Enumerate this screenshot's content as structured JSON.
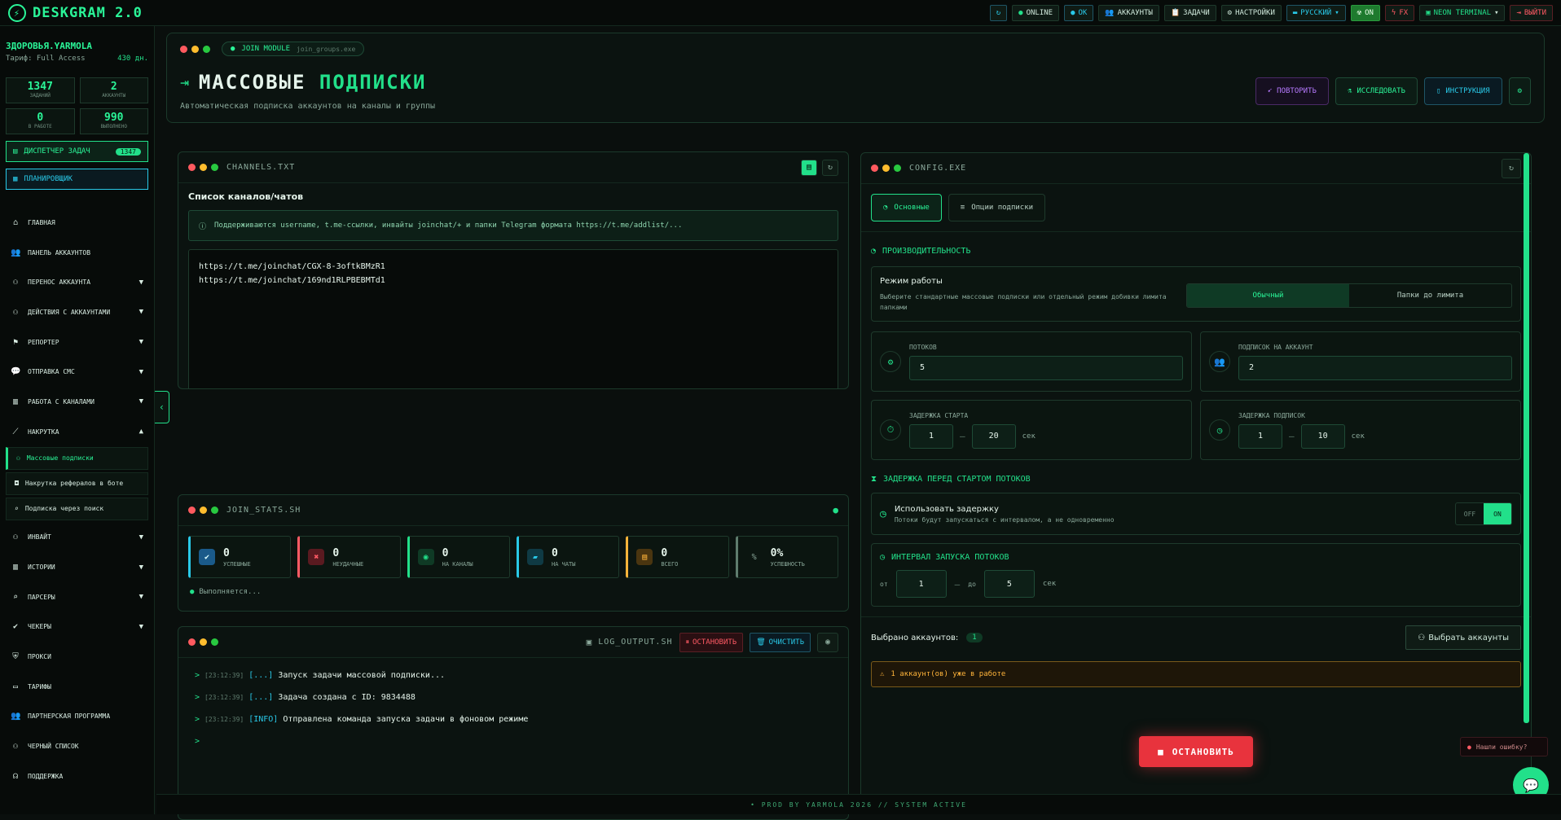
{
  "app": {
    "title": "DESKGRAM 2.0"
  },
  "topbar": {
    "online": "ONLINE",
    "ok": "OK",
    "accounts": "АККАУНТЫ",
    "tasks": "ЗАДАЧИ",
    "settings": "НАСТРОЙКИ",
    "language": "РУССКИЙ",
    "on": "ON",
    "fx": "FX",
    "theme": "NEON TERMINAL",
    "logout": "ВЫЙТИ"
  },
  "user": {
    "name": "ЗДОРОВЬЯ.YARMOLA",
    "plan_label": "Тариф: Full Access",
    "days": "430 дн."
  },
  "stats": [
    {
      "n": "1347",
      "l": "ЗАДАНИЙ"
    },
    {
      "n": "2",
      "l": "АККАУНТЫ"
    },
    {
      "n": "0",
      "l": "В РАБОТЕ"
    },
    {
      "n": "990",
      "l": "ВЫПОЛНЕНО"
    }
  ],
  "sidebar": {
    "dispatcher": "ДИСПЕТЧЕР ЗАДАЧ",
    "dispatcher_count": "1347",
    "scheduler": "ПЛАНИРОВЩИК",
    "items": [
      {
        "label": "ГЛАВНАЯ",
        "ch": ""
      },
      {
        "label": "ПАНЕЛЬ АККАУНТОВ",
        "ch": ""
      },
      {
        "label": "ПЕРЕНОС АККАУНТА",
        "ch": "▼"
      },
      {
        "label": "ДЕЙСТВИЯ С АККАУНТАМИ",
        "ch": "▼"
      },
      {
        "label": "РЕПОРТЕР",
        "ch": "▼"
      },
      {
        "label": "ОТПРАВКА СМС",
        "ch": "▼"
      },
      {
        "label": "РАБОТА С КАНАЛАМИ",
        "ch": "▼"
      },
      {
        "label": "НАКРУТКА",
        "ch": "▲"
      }
    ],
    "subitems": [
      "Массовые подписки",
      "Накрутка рефералов в боте",
      "Подписка через поиск"
    ],
    "items2": [
      {
        "label": "ИНВАЙТ",
        "ch": "▼"
      },
      {
        "label": "ИСТОРИИ",
        "ch": "▼"
      },
      {
        "label": "ПАРСЕРЫ",
        "ch": "▼"
      },
      {
        "label": "ЧЕКЕРЫ",
        "ch": "▼"
      },
      {
        "label": "ПРОКСИ",
        "ch": ""
      },
      {
        "label": "ТАРИФЫ",
        "ch": ""
      },
      {
        "label": "ПАРТНЕРСКАЯ ПРОГРАММА",
        "ch": ""
      },
      {
        "label": "ЧЕРНЫЙ СПИСОК",
        "ch": ""
      },
      {
        "label": "ПОДДЕРЖКА",
        "ch": ""
      }
    ]
  },
  "header": {
    "module": "JOIN MODULE",
    "module_file": "join_groups.exe",
    "title_a": "МАССОВЫЕ ",
    "title_b": "ПОДПИСКИ",
    "subtitle": "Автоматическая подписка аккаунтов на каналы и группы",
    "btn_repeat": "ПОВТОРИТЬ",
    "btn_explore": "ИССЛЕДОВАТЬ",
    "btn_guide": "ИНСТРУКЦИЯ"
  },
  "channels": {
    "file": "CHANNELS.TXT",
    "heading": "Список каналов/чатов",
    "info": "Поддерживаются username, t.me-ссылки, инвайты joinchat/+ и папки Telegram формата https://t.me/addlist/...",
    "lines": [
      "https://t.me/joinchat/CGX-8-3oftkBMzR1",
      "https://t.me/joinchat/169nd1RLPBEBMTd1"
    ]
  },
  "join_stats": {
    "file": "JOIN_STATS.SH",
    "cards": [
      {
        "n": "0",
        "l": "УСПЕШНЫЕ"
      },
      {
        "n": "0",
        "l": "НЕУДАЧНЫЕ"
      },
      {
        "n": "0",
        "l": "НА КАНАЛЫ"
      },
      {
        "n": "0",
        "l": "НА ЧАТЫ"
      },
      {
        "n": "0",
        "l": "ВСЕГО"
      },
      {
        "n": "0%",
        "l": "УСПЕШНОСТЬ"
      }
    ],
    "status": "Выполняется..."
  },
  "log": {
    "file": "LOG_OUTPUT.SH",
    "stop": "ОСТАНОВИТЬ",
    "clear": "ОЧИСТИТЬ",
    "lines": [
      {
        "t": "[23:12:39]",
        "tag": "[...]",
        "msg": "Запуск задачи массовой подписки..."
      },
      {
        "t": "[23:12:39]",
        "tag": "[...]",
        "msg": "Задача создана с ID: 9834488"
      },
      {
        "t": "[23:12:39]",
        "tag": "[INFO]",
        "msg": "Отправлена команда запуска задачи в фоновом режиме"
      }
    ]
  },
  "config": {
    "file": "CONFIG.EXE",
    "tab_main": "Основные",
    "tab_opts": "Опции подписки",
    "perf": "ПРОИЗВОДИТЕЛЬНОСТЬ",
    "mode_title": "Режим работы",
    "mode_desc": "Выберите стандартные массовые подписки или отдельный режим добивки лимита папками",
    "mode_normal": "Обычный",
    "mode_folders": "Папки до лимита",
    "threads_label": "ПОТОКОВ",
    "threads": "5",
    "subs_label": "ПОДПИСОК НА АККАУНТ",
    "subs": "2",
    "start_delay_label": "ЗАДЕРЖКА СТАРТА",
    "start_from": "1",
    "start_to": "20",
    "sec": "сек",
    "sub_delay_label": "ЗАДЕРЖКА ПОДПИСОК",
    "sub_from": "1",
    "sub_to": "10",
    "delay_section": "ЗАДЕРЖКА ПЕРЕД СТАРТОМ ПОТОКОВ",
    "use_delay": "Использовать задержку",
    "use_delay_desc": "Потоки будут запускаться с интервалом, а не одновременно",
    "off": "OFF",
    "on": "ON",
    "interval": "ИНТЕРВАЛ ЗАПУСКА ПОТОКОВ",
    "from": "от",
    "to": "до",
    "int_from": "1",
    "int_to": "5",
    "selected_label": "Выбрано аккаунтов:",
    "selected": "1",
    "choose": "Выбрать аккаунты",
    "warn": "1 аккаунт(ов) уже в работе"
  },
  "stop_main": "ОСТАНОВИТЬ",
  "bug": "Нашли ошибку?",
  "footer": "• PROD BY YARMOLA 2026  // SYSTEM ACTIVE"
}
